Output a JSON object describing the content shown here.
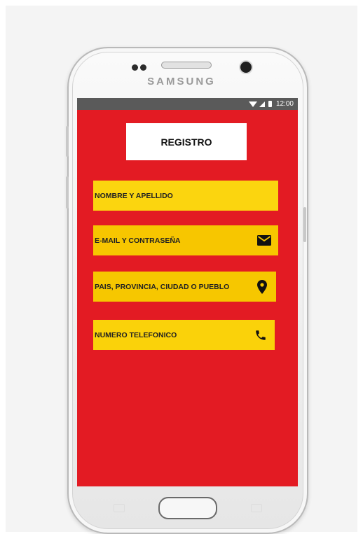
{
  "phone": {
    "brand": "SAMSUNG"
  },
  "statusbar": {
    "time": "12:00"
  },
  "form": {
    "title": "REGISTRO",
    "fields": [
      {
        "label": "NOMBRE Y APELLIDO",
        "icon": ""
      },
      {
        "label": "E-MAIL Y CONTRASEÑA",
        "icon": "envelope-icon"
      },
      {
        "label": "PAIS, PROVINCIA, CIUDAD O PUEBLO",
        "icon": "location-pin-icon"
      },
      {
        "label": "NUMERO TELEFONICO",
        "icon": "phone-icon"
      }
    ]
  },
  "colors": {
    "screen_background": "#e31b23",
    "field_background": "#f7c500",
    "status_bar": "#5a5a5a",
    "title_background": "#ffffff"
  }
}
